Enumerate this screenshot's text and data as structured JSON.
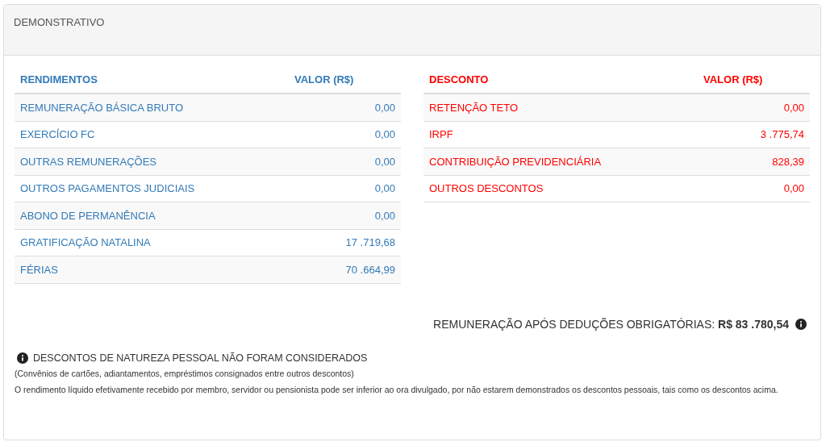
{
  "panel": {
    "title": "DEMONSTRATIVO"
  },
  "tables": [
    {
      "kind": "income",
      "columns": [
        "RENDIMENTOS",
        "VALOR (R$)"
      ],
      "rows": [
        {
          "label": "REMUNERAÇÃO BÁSICA BRUTO",
          "value": "0,00"
        },
        {
          "label": "EXERCÍCIO FC",
          "value": "0,00"
        },
        {
          "label": "OUTRAS REMUNERAÇÕES",
          "value": "0,00"
        },
        {
          "label": "OUTROS PAGAMENTOS JUDICIAIS",
          "value": "0,00"
        },
        {
          "label": "ABONO DE PERMANÊNCIA",
          "value": "0,00"
        },
        {
          "label": "GRATIFICAÇÃO NATALINA",
          "value": "17 .719,68"
        },
        {
          "label": "FÉRIAS",
          "value": "70 .664,99"
        }
      ]
    },
    {
      "kind": "deduction",
      "columns": [
        "DESCONTO",
        "VALOR (R$)"
      ],
      "rows": [
        {
          "label": "RETENÇÃO TETO",
          "value": "0,00"
        },
        {
          "label": "IRPF",
          "value": "3 .775,74"
        },
        {
          "label": "CONTRIBUIÇÃO PREVIDENCIÁRIA",
          "value": "828,39"
        },
        {
          "label": "OUTROS DESCONTOS",
          "value": "0,00"
        }
      ]
    }
  ],
  "total": "REMUNERAÇÃO APÓS DEDUÇÕES OBRIGATÓRIAS: **R$ 83 .780,54**",
  "notice": {
    "title": "DESCONTOS DE NATUREZA PESSOAL NÃO FORAM CONSIDERADOS",
    "lines": [
      "(Convênios de cartões, adiantamentos, empréstimos consignados entre outros descontos)",
      "O rendimento líquido efetivamente recebido por membro, servidor ou pensionista pode ser inferior ao ora divulgado, por não estarem demonstrados os descontos pessoais, tais como os descontos acima."
    ]
  }
}
